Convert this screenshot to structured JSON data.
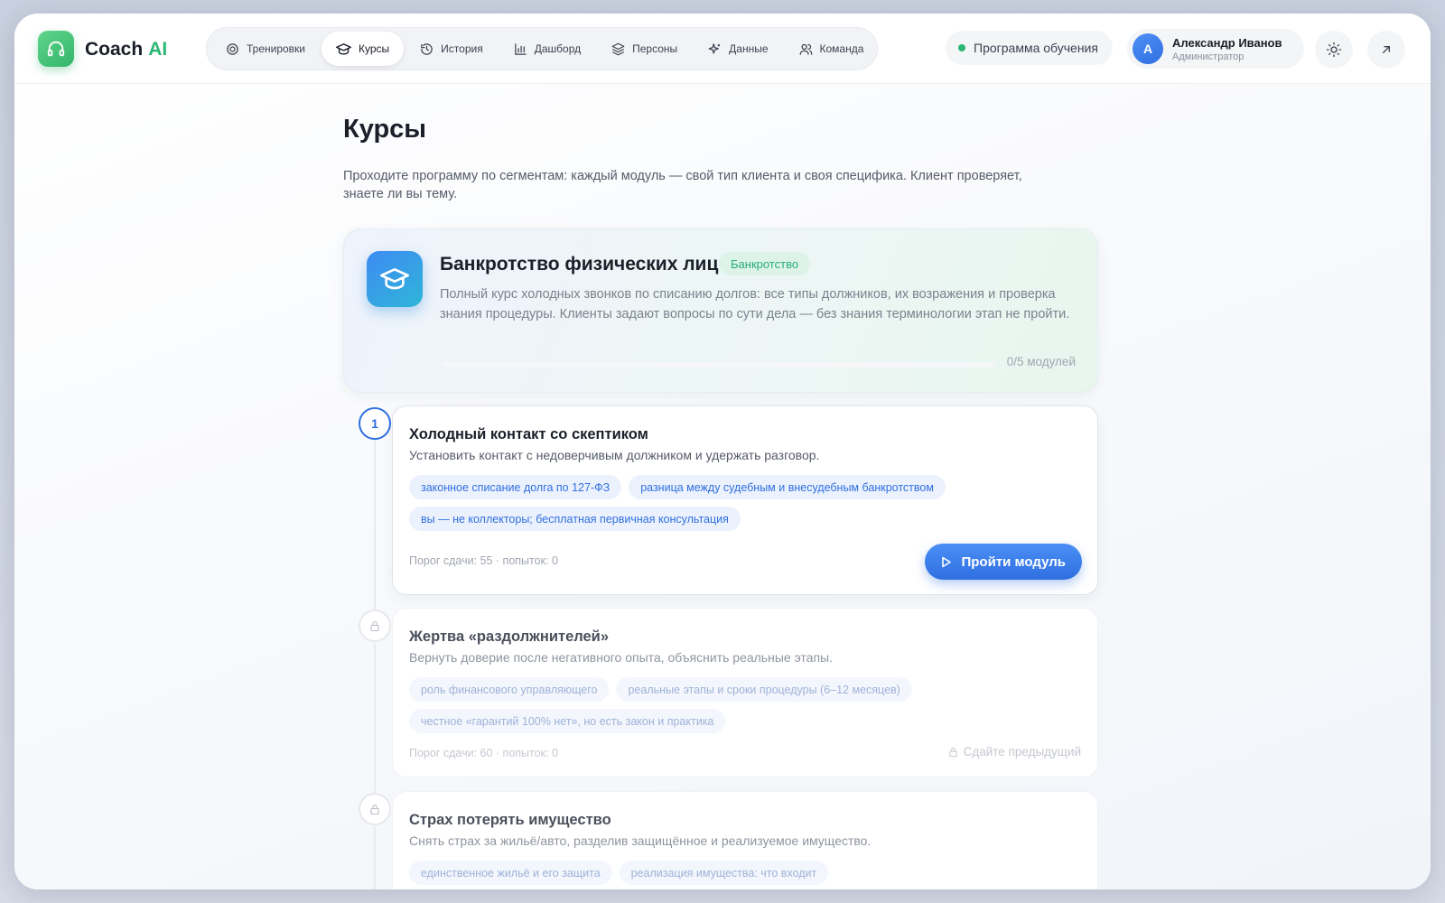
{
  "brand": {
    "name": "Coach",
    "suffix": "AI"
  },
  "nav": [
    {
      "label": "Тренировки",
      "icon": "target-icon",
      "active": false
    },
    {
      "label": "Курсы",
      "icon": "graduation-cap-icon",
      "active": true
    },
    {
      "label": "История",
      "icon": "history-icon",
      "active": false
    },
    {
      "label": "Дашборд",
      "icon": "bar-chart-icon",
      "active": false
    },
    {
      "label": "Персоны",
      "icon": "layers-icon",
      "active": false
    },
    {
      "label": "Данные",
      "icon": "sparkle-icon",
      "active": false
    },
    {
      "label": "Команда",
      "icon": "users-icon",
      "active": false
    }
  ],
  "program": {
    "label": "Программа обучения",
    "status_color": "#2bb673"
  },
  "user": {
    "initial": "А",
    "name": "Александр Иванов",
    "role": "Администратор"
  },
  "page": {
    "title": "Курсы",
    "subtitle": "Проходите программу по сегментам: каждый модуль — свой тип клиента и своя специфика. Клиент проверяет, знаете ли вы тему."
  },
  "course": {
    "title": "Банкротство физических лиц",
    "badge": "Банкротство",
    "description": "Полный курс холодных звонков по списанию долгов: все типы должников, их возражения и проверка знания процедуры. Клиенты задают вопросы по сути дела — без знания терминологии этап не пройти.",
    "progress_label": "0/5 модулей",
    "progress_fraction": 0
  },
  "modules": [
    {
      "number": "1",
      "title": "Холодный контакт со скептиком",
      "description": "Установить контакт с недоверчивым должником и удержать разговор.",
      "tags": [
        "законное списание долга по 127-ФЗ",
        "разница между судебным и внесудебным банкротством",
        "вы — не коллекторы; бесплатная первичная консультация"
      ],
      "meta": "Порог сдачи: 55 · попыток: 0",
      "action": "Пройти модуль",
      "locked": false
    },
    {
      "title": "Жертва «раздолжнителей»",
      "description": "Вернуть доверие после негативного опыта, объяснить реальные этапы.",
      "tags": [
        "роль финансового управляющего",
        "реальные этапы и сроки процедуры (6–12 месяцев)",
        "честное «гарантий 100% нет», но есть закон и практика"
      ],
      "meta": "Порог сдачи: 60 · попыток: 0",
      "locked_hint": "Сдайте предыдущий",
      "locked": true
    },
    {
      "title": "Страх потерять имущество",
      "description": "Снять страх за жильё/авто, разделив защищённое и реализуемое имущество.",
      "tags": [
        "единственное жильё и его защита",
        "реализация имущества: что входит"
      ],
      "locked": true
    }
  ],
  "colors": {
    "accent": "#2f6fe0",
    "brand_green": "#2bb673"
  }
}
